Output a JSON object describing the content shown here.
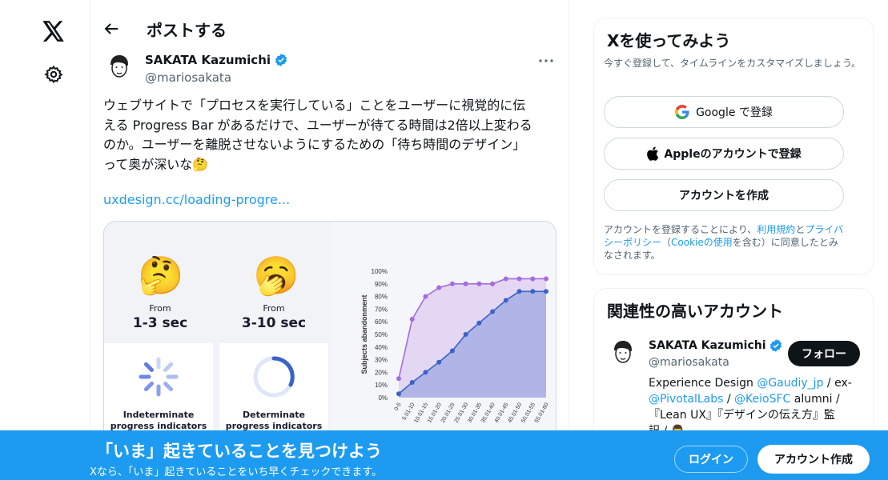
{
  "colors": {
    "accent": "#1d9bf0",
    "text": "#0f1419",
    "muted": "#536471",
    "border": "#eff3f4"
  },
  "nav": {
    "logo_icon": "x-logo-icon",
    "settings_icon": "gear-icon"
  },
  "header": {
    "title": "ポストする",
    "back_icon": "arrow-left-icon"
  },
  "post": {
    "author_name": "SAKATA Kazumichi",
    "author_handle": "@mariosakata",
    "text": "ウェブサイトで「プロセスを実行している」ことをユーザーに視覚的に伝\nえる Progress Bar があるだけで、ユーザーが待てる時間は2倍以上変わる\nのか。ユーザーを離脱させないようにするための「待ち時間のデザイン」\nって奥が深いな🤔",
    "link": "uxdesign.cc/loading-progre...",
    "media": {
      "card1": {
        "emoji": "🤔",
        "from": "From",
        "range": "1-3 sec"
      },
      "card2": {
        "emoji": "🥱",
        "from": "From",
        "range": "3-10 sec"
      },
      "card3": {
        "line1": "Indeterminate",
        "line2": "progress indicators"
      },
      "card4": {
        "line1": "Determinate",
        "line2": "progress indicators"
      }
    }
  },
  "chart_data": {
    "type": "line",
    "ylabel": "Subjects abandonment",
    "y_ticks": [
      "100%",
      "90%",
      "80%",
      "70%",
      "60%",
      "50%",
      "40%",
      "30%",
      "20%",
      "10%",
      "0%"
    ],
    "x": [
      "0-5",
      "5.01-10",
      "10.01-15",
      "15.01-20",
      "20.01-25",
      "25.01-30",
      "30.01-35",
      "35.01-40",
      "40.01-45",
      "45.01-50",
      "50.01-55",
      "55.01-60"
    ],
    "ylim": [
      0,
      100
    ],
    "series": [
      {
        "values": [
          15,
          62,
          80,
          87,
          90,
          90,
          90,
          90,
          94,
          94,
          94,
          94
        ],
        "color": "#a56be0"
      },
      {
        "values": [
          3,
          12,
          20,
          28,
          37,
          50,
          59,
          68,
          77,
          84,
          84,
          84
        ],
        "color": "#3b63c6"
      }
    ]
  },
  "signup_box": {
    "title": "Xを使ってみよう",
    "subtitle": "今すぐ登録して、タイムラインをカスタマイズしましょう。",
    "google_label": "Google で登録",
    "apple_label": "Appleのアカウントで登録",
    "create_label": "アカウントを作成",
    "terms_1": "アカウントを登録することにより、",
    "terms_link1": "利用規約",
    "terms_2": "と",
    "terms_link2": "プライバシーポリシー",
    "terms_3": "（",
    "terms_link3": "Cookieの使用",
    "terms_4": "を含む）に同意したとみなされます。"
  },
  "related": {
    "title": "関連性の高いアカウント",
    "name": "SAKATA Kazumichi",
    "handle": "@mariosakata",
    "follow_label": "フォロー",
    "bio_1": "Experience Design ",
    "bio_link1": "@Gaudiy_jp",
    "bio_2": " / ex-",
    "bio_link2": "@PivotalLabs",
    "bio_3": " / ",
    "bio_link3": "@KeioSFC",
    "bio_4": " alumni /",
    "bio_5": "『Lean UX』『デザインの伝え方』監",
    "bio_6": "訳 / 👨"
  },
  "banner": {
    "title": "「いま」起きていることを見つけよう",
    "subtitle": "Xなら、「いま」起きていることをいち早くチェックできます。",
    "login_label": "ログイン",
    "signup_label": "アカウント作成"
  }
}
